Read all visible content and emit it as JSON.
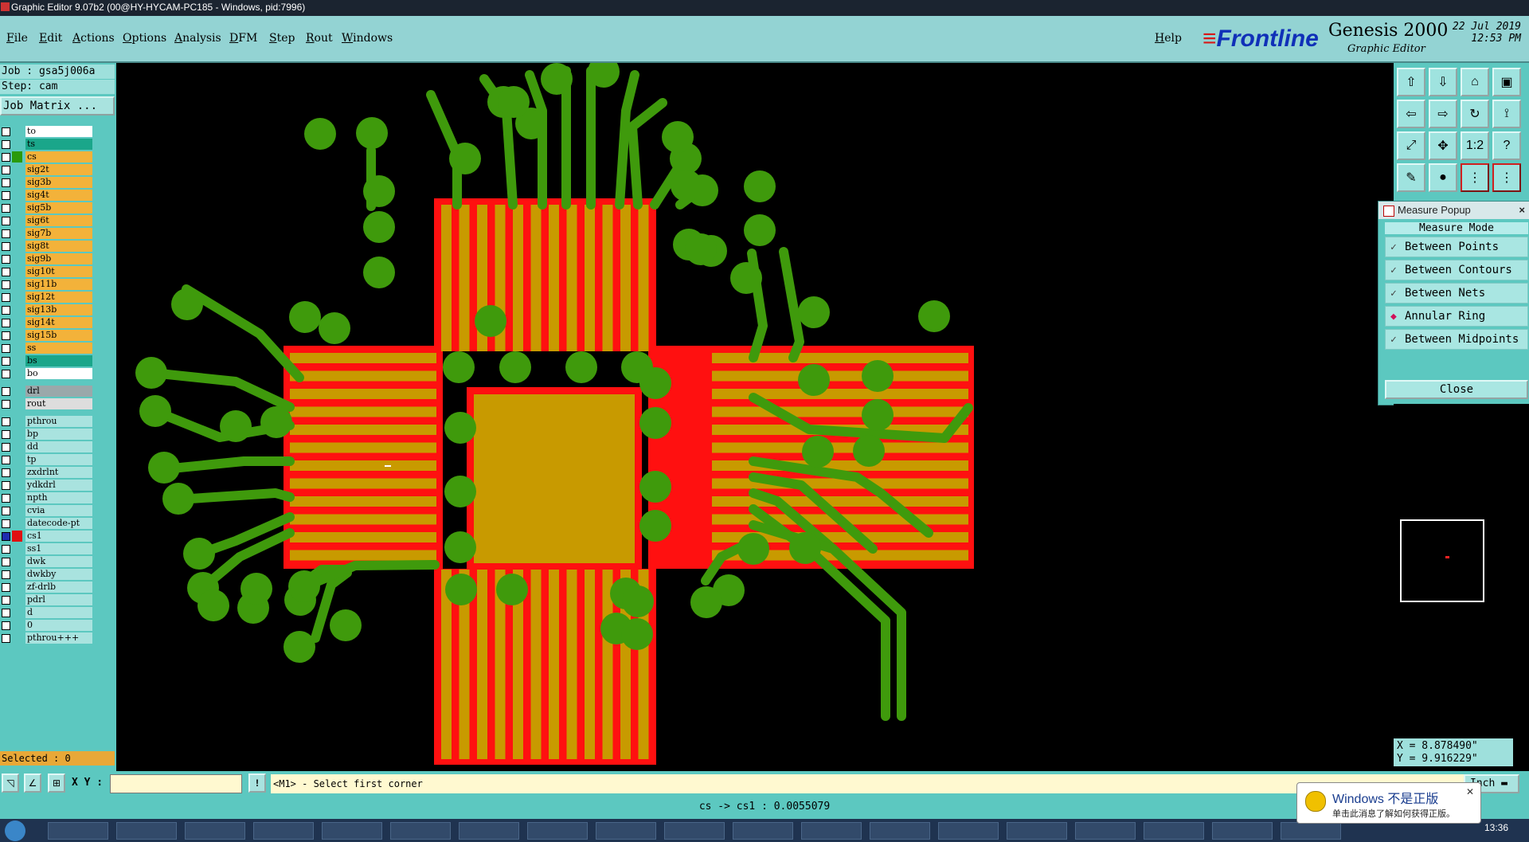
{
  "window": {
    "title": "Graphic Editor 9.07b2 (00@HY-HYCAM-PC185 - Windows, pid:7996)"
  },
  "menu": {
    "items": [
      "File",
      "Edit",
      "Actions",
      "Options",
      "Analysis",
      "DFM",
      "Step",
      "Rout",
      "Windows"
    ],
    "help": "Help"
  },
  "brand": {
    "logo": "Frontline",
    "product": "Genesis 2000",
    "subtitle": "Graphic Editor",
    "date": "22 Jul 2019",
    "time": "12:53 PM"
  },
  "job": {
    "job_line": "Job : gsa5j006a",
    "step_line": "Step: cam",
    "matrix_button": "Job Matrix ..."
  },
  "layers": {
    "group1": [
      {
        "name": "to",
        "color": "#ffffff"
      },
      {
        "name": "ts",
        "color": "#1aa68a"
      },
      {
        "name": "cs",
        "color": "#f3b23a",
        "active": true
      },
      {
        "name": "sig2t",
        "color": "#f3b23a"
      },
      {
        "name": "sig3b",
        "color": "#f3b23a"
      },
      {
        "name": "sig4t",
        "color": "#f3b23a"
      },
      {
        "name": "sig5b",
        "color": "#f3b23a"
      },
      {
        "name": "sig6t",
        "color": "#f3b23a"
      },
      {
        "name": "sig7b",
        "color": "#f3b23a"
      },
      {
        "name": "sig8t",
        "color": "#f3b23a"
      },
      {
        "name": "sig9b",
        "color": "#f3b23a"
      },
      {
        "name": "sig10t",
        "color": "#f3b23a"
      },
      {
        "name": "sig11b",
        "color": "#f3b23a"
      },
      {
        "name": "sig12t",
        "color": "#f3b23a"
      },
      {
        "name": "sig13b",
        "color": "#f3b23a"
      },
      {
        "name": "sig14t",
        "color": "#f3b23a"
      },
      {
        "name": "sig15b",
        "color": "#f3b23a"
      },
      {
        "name": "ss",
        "color": "#f3b23a"
      },
      {
        "name": "bs",
        "color": "#1aa68a"
      },
      {
        "name": "bo",
        "color": "#ffffff"
      }
    ],
    "group2": [
      {
        "name": "drl",
        "color": "#9aa8aa"
      },
      {
        "name": "rout",
        "color": "#dddddd"
      }
    ],
    "group3": [
      {
        "name": "pthrou",
        "color": "#a9e3df"
      },
      {
        "name": "bp",
        "color": "#a9e3df"
      },
      {
        "name": "dd",
        "color": "#a9e3df"
      },
      {
        "name": "tp",
        "color": "#a9e3df"
      },
      {
        "name": "zxdrlnt",
        "color": "#a9e3df"
      },
      {
        "name": "ydkdrl",
        "color": "#a9e3df"
      },
      {
        "name": "npth",
        "color": "#a9e3df"
      },
      {
        "name": "cvia",
        "color": "#a9e3df"
      },
      {
        "name": "datecode-pt",
        "color": "#a9e3df"
      },
      {
        "name": "cs1",
        "color": "#a9e3df",
        "selected": true
      },
      {
        "name": "ss1",
        "color": "#a9e3df"
      },
      {
        "name": "dwk",
        "color": "#a9e3df"
      },
      {
        "name": "dwkby",
        "color": "#a9e3df"
      },
      {
        "name": "zf-drlb",
        "color": "#a9e3df"
      },
      {
        "name": "pdrl",
        "color": "#a9e3df"
      },
      {
        "name": "d",
        "color": "#a9e3df"
      },
      {
        "name": "0",
        "color": "#a9e3df"
      },
      {
        "name": "pthrou+++",
        "color": "#a9e3df"
      }
    ]
  },
  "selected_text": "Selected : 0",
  "measure_popup": {
    "title": "Measure Popup",
    "mode_label": "Measure Mode",
    "options": [
      {
        "label": "Between Points",
        "checked": false
      },
      {
        "label": "Between Contours",
        "checked": false
      },
      {
        "label": "Between Nets",
        "checked": false
      },
      {
        "label": "Annular Ring",
        "checked": true
      },
      {
        "label": "Between Midpoints",
        "checked": false
      }
    ],
    "close": "Close"
  },
  "toolbox": {
    "icons": [
      "zoom-home-icon",
      "zoom-back-icon",
      "house-icon",
      "window-icon",
      "pan-left-icon",
      "pan-right-icon",
      "redraw-icon",
      "snap-icon",
      "fit-icon",
      "center-icon",
      "ratio-label",
      "help-icon",
      "lasso-icon",
      "measure-icon",
      "net-icon",
      "net2-icon"
    ],
    "ratio_text": "1:2",
    "help_text": "?"
  },
  "coords": {
    "x": "X = 8.878490\"",
    "y": "Y = 9.916229\""
  },
  "command": {
    "xy_label": "X Y :",
    "xy_value": "",
    "prompt": "<M1> - Select first corner",
    "units": "Inch"
  },
  "status": "cs -> cs1 : 0.0055079",
  "notification": {
    "title": "Windows 不是正版",
    "body": "单击此消息了解如何获得正版。"
  },
  "taskbar": {
    "clock": "13:36"
  },
  "colors": {
    "trace": "#3f9a0c",
    "pad": "#c89a00",
    "mask": "#ff1010",
    "panel": "#5cc8c0"
  }
}
